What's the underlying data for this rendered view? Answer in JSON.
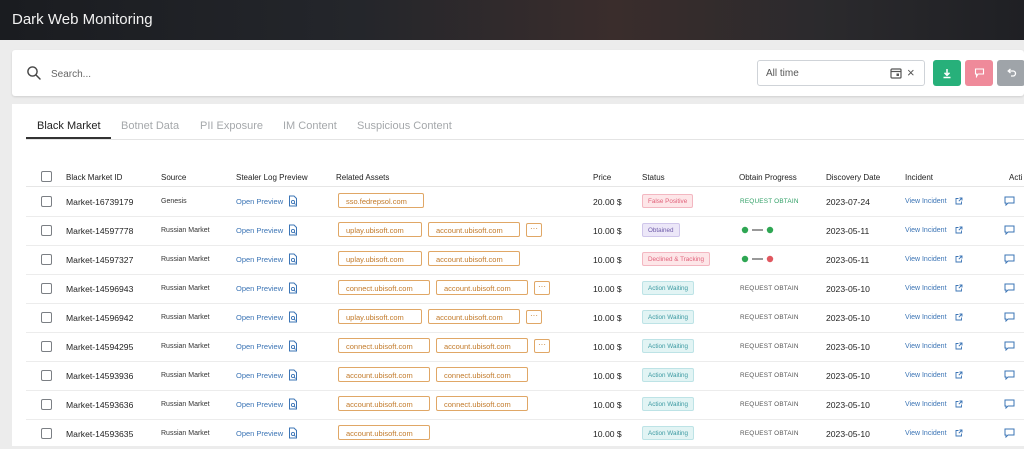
{
  "app": {
    "title": "Dark Web Monitoring"
  },
  "search": {
    "placeholder": "Search...",
    "date_value": "All time",
    "clear": "×"
  },
  "toolbar": {
    "download_icon": "download-icon",
    "flag_icon": "flag-icon",
    "undo_icon": "undo-icon"
  },
  "tabs": [
    {
      "label": "Black Market",
      "active": true
    },
    {
      "label": "Botnet Data",
      "active": false
    },
    {
      "label": "PII Exposure",
      "active": false
    },
    {
      "label": "IM Content",
      "active": false
    },
    {
      "label": "Suspicious Content",
      "active": false
    }
  ],
  "table": {
    "headers": {
      "id": "Black Market ID",
      "source": "Source",
      "preview": "Stealer Log Preview",
      "assets": "Related Assets",
      "price": "Price",
      "status": "Status",
      "obtain": "Obtain Progress",
      "date": "Discovery Date",
      "incident": "Incident",
      "actions": "Acti"
    },
    "preview_label": "Open Preview",
    "incident_label": "View Incident",
    "more_label": "···",
    "rows": [
      {
        "id": "Market-16739179",
        "source": "Genesis",
        "assets": [
          "sso.fedrepsol.com"
        ],
        "more": false,
        "price": "20.00 $",
        "status": "False Positive",
        "status_kind": "fp",
        "obtain": "REQUEST OBTAIN",
        "obtain_kind": "text-green",
        "date": "2023-07-24"
      },
      {
        "id": "Market-14597778",
        "source": "Russian Market",
        "assets": [
          "uplay.ubisoft.com",
          "account.ubisoft.com"
        ],
        "more": true,
        "price": "10.00 $",
        "status": "Obtained",
        "status_kind": "ob",
        "obtain": "",
        "obtain_kind": "progress-green",
        "date": "2023-05-11"
      },
      {
        "id": "Market-14597327",
        "source": "Russian Market",
        "assets": [
          "uplay.ubisoft.com",
          "account.ubisoft.com"
        ],
        "more": false,
        "price": "10.00 $",
        "status": "Declined & Tracking",
        "status_kind": "dt",
        "obtain": "",
        "obtain_kind": "progress-red",
        "date": "2023-05-11"
      },
      {
        "id": "Market-14596943",
        "source": "Russian Market",
        "assets": [
          "connect.ubisoft.com",
          "account.ubisoft.com"
        ],
        "more": true,
        "price": "10.00 $",
        "status": "Action Waiting",
        "status_kind": "aw",
        "obtain": "REQUEST OBTAIN",
        "obtain_kind": "text",
        "date": "2023-05-10"
      },
      {
        "id": "Market-14596942",
        "source": "Russian Market",
        "assets": [
          "uplay.ubisoft.com",
          "account.ubisoft.com"
        ],
        "more": true,
        "price": "10.00 $",
        "status": "Action Waiting",
        "status_kind": "aw",
        "obtain": "REQUEST OBTAIN",
        "obtain_kind": "text",
        "date": "2023-05-10"
      },
      {
        "id": "Market-14594295",
        "source": "Russian Market",
        "assets": [
          "connect.ubisoft.com",
          "account.ubisoft.com"
        ],
        "more": true,
        "price": "10.00 $",
        "status": "Action Waiting",
        "status_kind": "aw",
        "obtain": "REQUEST OBTAIN",
        "obtain_kind": "text",
        "date": "2023-05-10"
      },
      {
        "id": "Market-14593936",
        "source": "Russian Market",
        "assets": [
          "account.ubisoft.com",
          "connect.ubisoft.com"
        ],
        "more": false,
        "price": "10.00 $",
        "status": "Action Waiting",
        "status_kind": "aw",
        "obtain": "REQUEST OBTAIN",
        "obtain_kind": "text",
        "date": "2023-05-10"
      },
      {
        "id": "Market-14593636",
        "source": "Russian Market",
        "assets": [
          "account.ubisoft.com",
          "connect.ubisoft.com"
        ],
        "more": false,
        "price": "10.00 $",
        "status": "Action Waiting",
        "status_kind": "aw",
        "obtain": "REQUEST OBTAIN",
        "obtain_kind": "text",
        "date": "2023-05-10"
      },
      {
        "id": "Market-14593635",
        "source": "Russian Market",
        "assets": [
          "account.ubisoft.com"
        ],
        "more": false,
        "price": "10.00 $",
        "status": "Action Waiting",
        "status_kind": "aw",
        "obtain": "REQUEST OBTAIN",
        "obtain_kind": "text",
        "date": "2023-05-10"
      }
    ]
  },
  "colors": {
    "accent_link": "#3b74b5",
    "asset_border": "#e0a766",
    "success": "#27b07a",
    "danger": "#e0617a"
  }
}
